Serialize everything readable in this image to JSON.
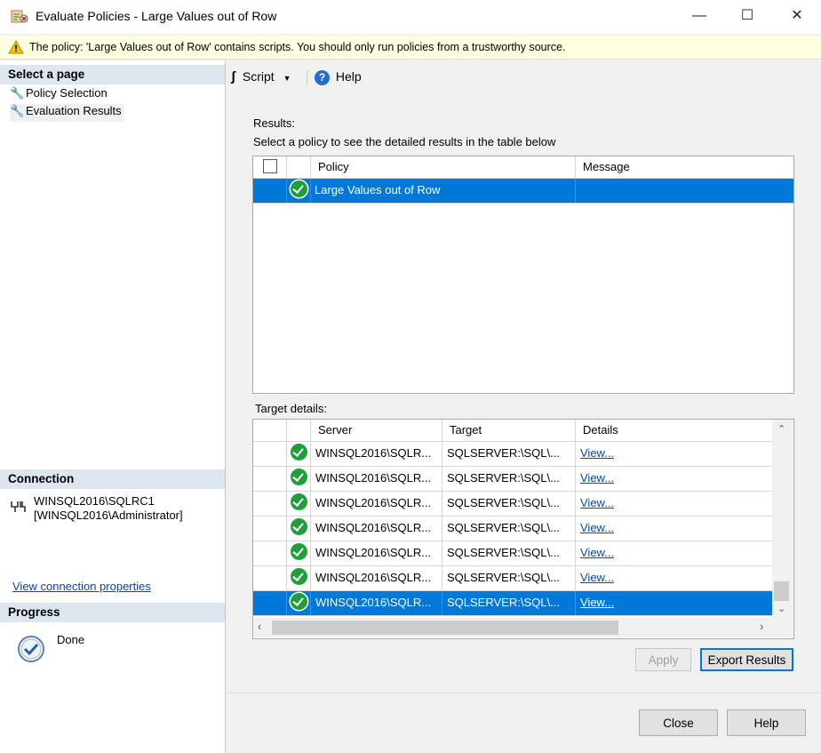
{
  "window": {
    "title": "Evaluate Policies - Large Values out of Row",
    "minimize_glyph": "—",
    "maximize_glyph": "☐",
    "close_glyph": "✕"
  },
  "warning": {
    "text": "The policy: 'Large Values out of Row' contains scripts. You should only run policies from a trustworthy source."
  },
  "sidebar": {
    "select_page_header": "Select a page",
    "pages": [
      {
        "label": "Policy Selection"
      },
      {
        "label": "Evaluation Results"
      }
    ],
    "connection_header": "Connection",
    "connection_server": "WINSQL2016\\SQLRC1",
    "connection_user": "[WINSQL2016\\Administrator]",
    "view_connection_link": "View connection properties",
    "progress_header": "Progress",
    "progress_status": "Done"
  },
  "toolbar": {
    "script_label": "Script",
    "help_label": "Help"
  },
  "results": {
    "label": "Results:",
    "subtitle": "Select a policy to see the detailed results in the table below",
    "columns": [
      "Policy",
      "Message"
    ],
    "rows": [
      {
        "policy": "Large Values out of Row",
        "message": "",
        "status": "success",
        "selected": true
      }
    ]
  },
  "target_details": {
    "label": "Target details:",
    "columns": [
      "Server",
      "Target",
      "Details"
    ],
    "rows": [
      {
        "server": "WINSQL2016\\SQLR...",
        "target": "SQLSERVER:\\SQL\\...",
        "details": "View...",
        "selected": false
      },
      {
        "server": "WINSQL2016\\SQLR...",
        "target": "SQLSERVER:\\SQL\\...",
        "details": "View...",
        "selected": false
      },
      {
        "server": "WINSQL2016\\SQLR...",
        "target": "SQLSERVER:\\SQL\\...",
        "details": "View...",
        "selected": false
      },
      {
        "server": "WINSQL2016\\SQLR...",
        "target": "SQLSERVER:\\SQL\\...",
        "details": "View...",
        "selected": false
      },
      {
        "server": "WINSQL2016\\SQLR...",
        "target": "SQLSERVER:\\SQL\\...",
        "details": "View...",
        "selected": false
      },
      {
        "server": "WINSQL2016\\SQLR...",
        "target": "SQLSERVER:\\SQL\\...",
        "details": "View...",
        "selected": false
      },
      {
        "server": "WINSQL2016\\SQLR...",
        "target": "SQLSERVER:\\SQL\\...",
        "details": "View...",
        "selected": true
      }
    ]
  },
  "buttons": {
    "apply": "Apply",
    "export_results": "Export Results",
    "close": "Close",
    "help": "Help"
  },
  "colors": {
    "selection": "#0078d7",
    "section_header": "#dde6ef",
    "warning_bg": "#ffffe1",
    "success": "#1f9e3a",
    "link": "#0645ad"
  }
}
